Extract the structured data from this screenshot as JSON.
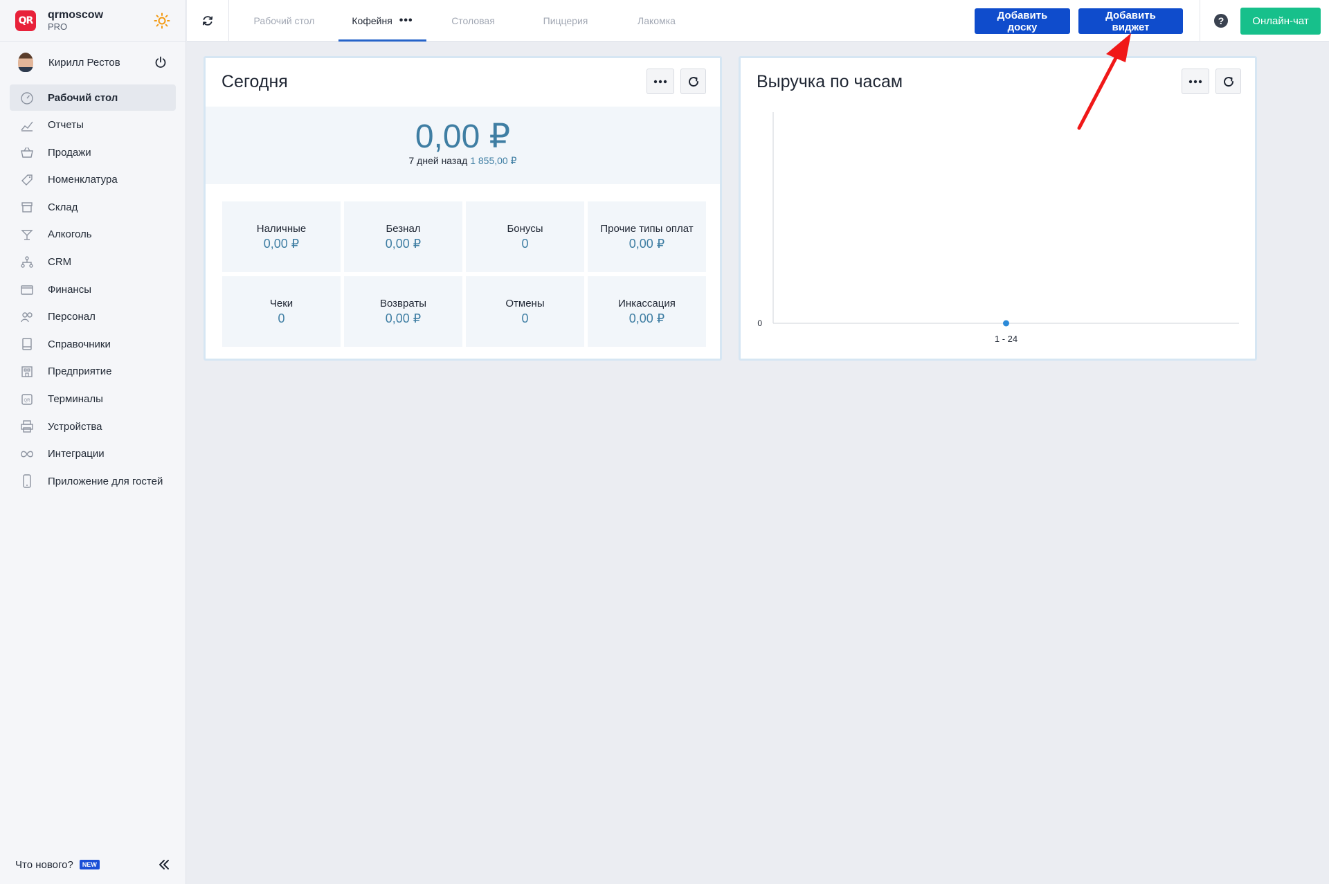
{
  "brand": {
    "logo_text": "QR",
    "name": "qrmoscow",
    "plan": "PRO"
  },
  "user": {
    "name": "Кирилл Рестов"
  },
  "nav": {
    "items": [
      {
        "label": "Рабочий стол",
        "icon": "dashboard-icon",
        "active": true
      },
      {
        "label": "Отчеты",
        "icon": "reports-icon"
      },
      {
        "label": "Продажи",
        "icon": "basket-icon"
      },
      {
        "label": "Номенклатура",
        "icon": "tag-icon"
      },
      {
        "label": "Склад",
        "icon": "warehouse-icon"
      },
      {
        "label": "Алкоголь",
        "icon": "cocktail-icon"
      },
      {
        "label": "CRM",
        "icon": "crm-icon"
      },
      {
        "label": "Финансы",
        "icon": "wallet-icon"
      },
      {
        "label": "Персонал",
        "icon": "staff-icon"
      },
      {
        "label": "Справочники",
        "icon": "book-icon"
      },
      {
        "label": "Предприятие",
        "icon": "building-icon"
      },
      {
        "label": "Терминалы",
        "icon": "qr-terminal-icon"
      },
      {
        "label": "Устройства",
        "icon": "printer-icon"
      },
      {
        "label": "Интеграции",
        "icon": "infinity-icon"
      },
      {
        "label": "Приложение для гостей",
        "icon": "phone-icon"
      }
    ]
  },
  "footer": {
    "whats_new": "Что нового?",
    "new_badge": "NEW"
  },
  "tabs": [
    {
      "label": "Рабочий стол",
      "active": false
    },
    {
      "label": "Кофейня",
      "active": true,
      "menu": "•••"
    },
    {
      "label": "Столовая",
      "active": false
    },
    {
      "label": "Пиццерия",
      "active": false
    },
    {
      "label": "Лакомка",
      "active": false
    }
  ],
  "toolbar": {
    "add_board": "Добавить доску",
    "add_widget": "Добавить виджет",
    "online_chat": "Онлайн-чат"
  },
  "today": {
    "title": "Сегодня",
    "total": "0,00 ₽",
    "compare_label": "7 дней назад",
    "compare_value": "1 855,00 ₽",
    "cells": [
      {
        "label": "Наличные",
        "value": "0,00 ₽"
      },
      {
        "label": "Безнал",
        "value": "0,00 ₽"
      },
      {
        "label": "Бонусы",
        "value": "0"
      },
      {
        "label": "Прочие типы оплат",
        "value": "0,00 ₽"
      },
      {
        "label": "Чеки",
        "value": "0"
      },
      {
        "label": "Возвраты",
        "value": "0,00 ₽"
      },
      {
        "label": "Отмены",
        "value": "0"
      },
      {
        "label": "Инкассация",
        "value": "0,00 ₽"
      }
    ]
  },
  "hourly": {
    "title": "Выручка по часам"
  },
  "chart_data": {
    "type": "line",
    "title": "Выручка по часам",
    "categories": [
      "1 - 24"
    ],
    "series": [
      {
        "values": [
          0
        ]
      }
    ],
    "y_ticks": [
      "0"
    ],
    "ylim": [
      0,
      1
    ],
    "grid": false,
    "color": "#2b8ad8"
  },
  "colors": {
    "primary": "#0f4ccc",
    "chat": "#17c08b",
    "accent_value": "#3f7ea3",
    "annotation_arrow": "#f01818"
  }
}
